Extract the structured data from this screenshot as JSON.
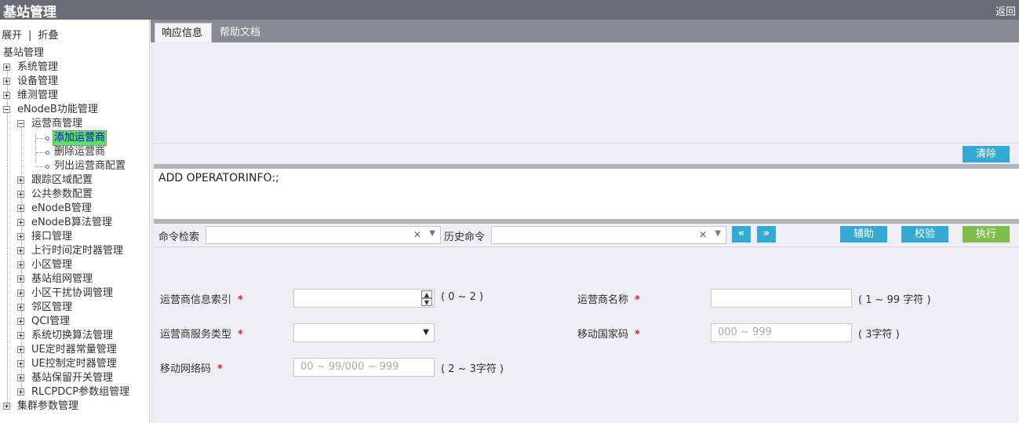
{
  "header": {
    "title": "基站管理",
    "back_label": "返回"
  },
  "sidebar": {
    "expand_label": "展开",
    "separator": "|",
    "collapse_label": "折叠",
    "tree": {
      "root": "基站管理",
      "items": [
        "系统管理",
        "设备管理",
        "维测管理",
        "eNodeB功能管理",
        "运营商管理",
        "添加运营商",
        "删除运营商",
        "列出运营商配置",
        "跟踪区域配置",
        "公共参数配置",
        "eNodeB管理",
        "eNodeB算法管理",
        "接口管理",
        "上行时间定时器管理",
        "小区管理",
        "基站组网管理",
        "小区干扰协调管理",
        "邻区管理",
        "QCI管理",
        "系统切换算法管理",
        "UE定时器常量管理",
        "UE控制定时器管理",
        "基站保留开关管理",
        "RLCPDCP参数组管理",
        "集群参数管理"
      ]
    }
  },
  "tabs": [
    {
      "label": "响应信息"
    },
    {
      "label": "帮助文档"
    }
  ],
  "response": {
    "clear_label": "清除"
  },
  "command": {
    "text": "ADD OPERATORINFO:;"
  },
  "toolbar": {
    "search_label": "命令检索",
    "search_value": "",
    "history_label": "历史命令",
    "history_value": "",
    "prev_icon": "«",
    "next_icon": "»",
    "assist_label": "辅助",
    "verify_label": "校验",
    "execute_label": "执行"
  },
  "form": {
    "operator_index": {
      "label": "运营商信息索引",
      "value": "",
      "hint": "( 0 ~ 2 )"
    },
    "operator_name": {
      "label": "运营商名称",
      "value": "",
      "hint": "( 1 ~ 99 字符 )"
    },
    "service_type": {
      "label": "运营商服务类型",
      "value": ""
    },
    "mcc": {
      "label": "移动国家码",
      "placeholder": "000 ~ 999",
      "hint": "( 3字符 )"
    },
    "mnc": {
      "label": "移动网络码",
      "placeholder": "00 ~ 99/000 ~ 999",
      "hint": "( 2 ~ 3字符 )"
    },
    "required_mark": "*"
  },
  "colors": {
    "titlebar": "#6b6b75",
    "accent_blue": "#33a9d3",
    "execute_green": "#7fbe4b",
    "selected_node": "#5de06a",
    "required": "#d9232d"
  }
}
